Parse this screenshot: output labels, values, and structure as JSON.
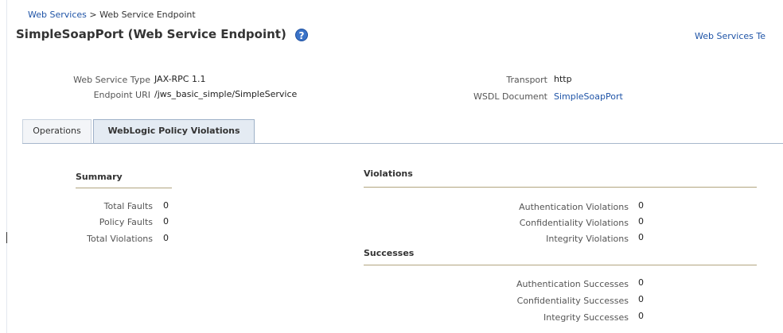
{
  "breadcrumb": {
    "root": "Web Services",
    "separator": " > ",
    "current": "Web Service Endpoint"
  },
  "page": {
    "title": "SimpleSoapPort (Web Service Endpoint)",
    "help_glyph": "?"
  },
  "header_link": "Web Services Te",
  "info": {
    "service_type_label": "Web Service Type",
    "service_type_value": "JAX-RPC 1.1",
    "endpoint_uri_label": "Endpoint URI",
    "endpoint_uri_value": "/jws_basic_simple/SimpleService",
    "transport_label": "Transport",
    "transport_value": "http",
    "wsdl_label": "WSDL Document",
    "wsdl_value": "SimpleSoapPort"
  },
  "tabs": [
    {
      "label": "Operations",
      "selected": false
    },
    {
      "label": "WebLogic Policy Violations",
      "selected": true
    }
  ],
  "summary": {
    "title": "Summary",
    "rows": [
      {
        "label": "Total Faults",
        "value": "0"
      },
      {
        "label": "Policy Faults",
        "value": "0"
      },
      {
        "label": "Total Violations",
        "value": "0"
      }
    ]
  },
  "violations": {
    "title": "Violations",
    "rows": [
      {
        "label": "Authentication Violations",
        "value": "0"
      },
      {
        "label": "Confidentiality Violations",
        "value": "0"
      },
      {
        "label": "Integrity Violations",
        "value": "0"
      }
    ]
  },
  "successes": {
    "title": "Successes",
    "rows": [
      {
        "label": "Authentication Successes",
        "value": "0"
      },
      {
        "label": "Confidentiality Successes",
        "value": "0"
      },
      {
        "label": "Integrity Successes",
        "value": "0"
      }
    ]
  },
  "colors": {
    "link": "#1f54a7",
    "help_icon": "#3a73c8",
    "section_rule": "#b2a57f",
    "tab_selected": "#e4ebf3"
  }
}
